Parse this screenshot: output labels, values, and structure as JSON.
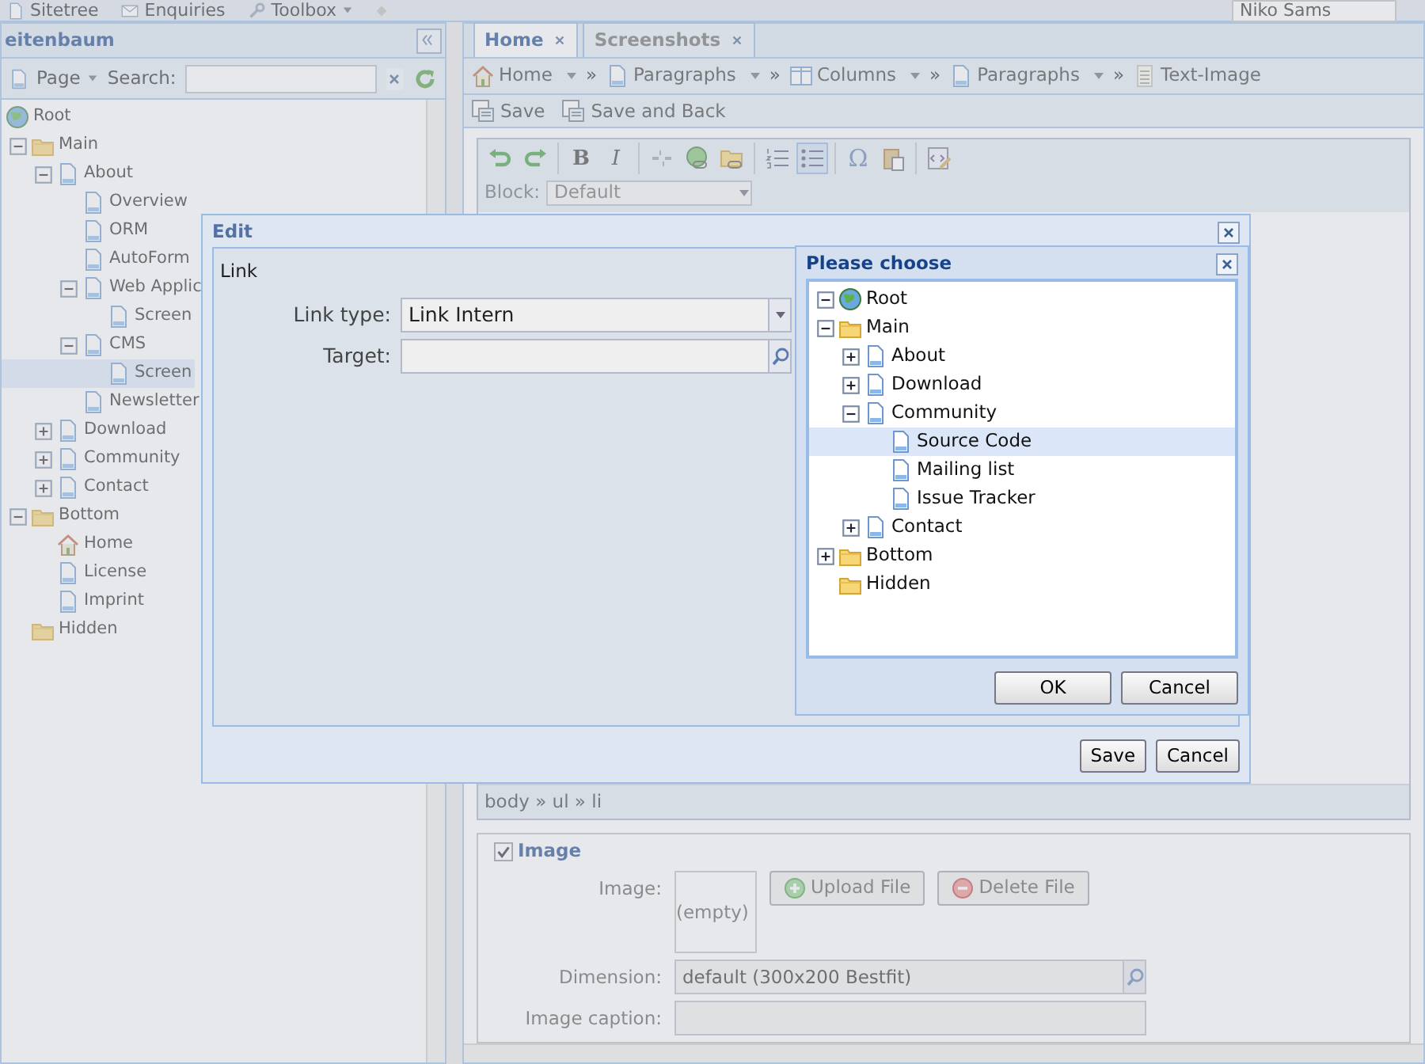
{
  "top_bar": {
    "items": [
      {
        "kind": "tree",
        "label": "Sitetree",
        "menu": false
      },
      {
        "kind": "mail",
        "label": "Enquiries",
        "menu": false
      },
      {
        "kind": "wrench",
        "label": "Toolbox",
        "menu": true
      }
    ],
    "user": "Niko Sams"
  },
  "sidebar": {
    "title": "eitenbaum",
    "page_menu": "Page",
    "search_label": "Search:",
    "tree": [
      {
        "kind": "globe",
        "label": "Root",
        "selected": false,
        "children": [
          {
            "kind": "folder",
            "label": "Main",
            "expanded": true,
            "selected": false,
            "children": [
              {
                "kind": "page",
                "label": "About",
                "expanded": true,
                "selected": false,
                "children": [
                  {
                    "kind": "page",
                    "label": "Overview",
                    "selected": false
                  },
                  {
                    "kind": "page",
                    "label": "ORM",
                    "selected": false
                  },
                  {
                    "kind": "page",
                    "label": "AutoForm",
                    "selected": false
                  },
                  {
                    "kind": "page",
                    "label": "Web Applic",
                    "expanded": true,
                    "selected": false,
                    "children": [
                      {
                        "kind": "page",
                        "label": "Screen",
                        "selected": false
                      }
                    ]
                  },
                  {
                    "kind": "page",
                    "label": "CMS",
                    "expanded": true,
                    "selected": false,
                    "children": [
                      {
                        "kind": "page",
                        "label": "Screen",
                        "selected": true
                      }
                    ]
                  },
                  {
                    "kind": "page",
                    "label": "Newsletter",
                    "selected": false
                  }
                ]
              },
              {
                "kind": "page",
                "label": "Download",
                "expanded": false,
                "selected": false
              },
              {
                "kind": "page",
                "label": "Community",
                "expanded": false,
                "selected": false
              },
              {
                "kind": "page",
                "label": "Contact",
                "expanded": false,
                "selected": false
              }
            ]
          },
          {
            "kind": "folder",
            "label": "Bottom",
            "expanded": true,
            "selected": false,
            "children": [
              {
                "kind": "home",
                "label": "Home",
                "selected": false
              },
              {
                "kind": "page",
                "label": "License",
                "selected": false
              },
              {
                "kind": "page",
                "label": "Imprint",
                "selected": false
              }
            ]
          },
          {
            "kind": "folder",
            "label": "Hidden",
            "selected": false
          }
        ]
      }
    ]
  },
  "tabs": [
    {
      "label": "Home",
      "selected": true
    },
    {
      "label": "Screenshots",
      "selected": false
    }
  ],
  "breadcrumb": [
    {
      "kind": "home",
      "label": "Home",
      "menu": true
    },
    {
      "kind": "separator",
      "label": "»"
    },
    {
      "kind": "page",
      "label": "Paragraphs",
      "menu": true
    },
    {
      "kind": "separator",
      "label": "»"
    },
    {
      "kind": "columns",
      "label": "Columns",
      "menu": true
    },
    {
      "kind": "separator",
      "label": "»"
    },
    {
      "kind": "page",
      "label": "Paragraphs",
      "menu": true
    },
    {
      "kind": "separator",
      "label": "»"
    },
    {
      "kind": "text",
      "label": "Text-Image",
      "menu": false
    }
  ],
  "actions": [
    {
      "label": "Save"
    },
    {
      "label": "Save and Back"
    }
  ],
  "editor": {
    "toolbar": [
      [
        {
          "kind": "undo",
          "pressed": false
        },
        {
          "kind": "redo",
          "pressed": false
        }
      ],
      [
        {
          "kind": "bold",
          "label": "B",
          "pressed": false
        },
        {
          "kind": "italic",
          "label": "I",
          "pressed": false
        }
      ],
      [
        {
          "kind": "unlink",
          "pressed": false
        },
        {
          "kind": "link",
          "pressed": false
        },
        {
          "kind": "link-folder",
          "pressed": false
        }
      ],
      [
        {
          "kind": "ordered-list",
          "pressed": false
        },
        {
          "kind": "bullet-list",
          "pressed": true
        }
      ],
      [
        {
          "kind": "symbol",
          "label": "Ω",
          "pressed": false
        },
        {
          "kind": "paste",
          "pressed": false
        }
      ],
      [
        {
          "kind": "source",
          "pressed": false
        }
      ]
    ],
    "block_label": "Block:",
    "block_value": "Default",
    "path": "body » ul » li"
  },
  "image_section": {
    "legend": "Image",
    "checked": true,
    "image_label": "Image:",
    "image_value": "(empty)",
    "buttons": [
      {
        "kind": "add",
        "label": "Upload File"
      },
      {
        "kind": "remove",
        "label": "Delete File"
      }
    ],
    "dimension_label": "Dimension:",
    "dimension_value": "default (300x200 Bestfit)",
    "caption_label": "Image caption:"
  },
  "edit_dialog": {
    "title": "Edit",
    "section": "Link",
    "fields": [
      {
        "kind": "select",
        "label": "Link type:",
        "value": "Link Intern"
      },
      {
        "kind": "search",
        "label": "Target:"
      }
    ],
    "buttons": [
      "Save",
      "Cancel"
    ]
  },
  "chooser_dialog": {
    "title": "Please choose",
    "tree": [
      {
        "kind": "globe",
        "label": "Root",
        "expanded": true,
        "selected": false,
        "children": [
          {
            "kind": "folder",
            "label": "Main",
            "expanded": true,
            "selected": false,
            "children": [
              {
                "kind": "page",
                "label": "About",
                "expanded": false,
                "selected": false
              },
              {
                "kind": "page",
                "label": "Download",
                "expanded": false,
                "selected": false
              },
              {
                "kind": "page",
                "label": "Community",
                "expanded": true,
                "selected": false,
                "children": [
                  {
                    "kind": "page",
                    "label": "Source Code",
                    "selected": true
                  },
                  {
                    "kind": "page",
                    "label": "Mailing list",
                    "selected": false
                  },
                  {
                    "kind": "page",
                    "label": "Issue Tracker",
                    "selected": false
                  }
                ]
              },
              {
                "kind": "page",
                "label": "Contact",
                "expanded": false,
                "selected": false
              }
            ]
          },
          {
            "kind": "folder",
            "label": "Bottom",
            "expanded": false,
            "selected": false
          },
          {
            "kind": "folder",
            "label": "Hidden",
            "selected": false
          }
        ]
      }
    ],
    "buttons": [
      "OK",
      "Cancel"
    ]
  }
}
